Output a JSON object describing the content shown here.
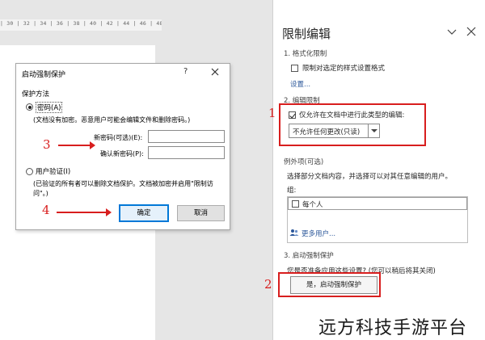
{
  "ruler": {
    "marks": "| 30 | 32 | 34 | 36 | 38 | 40 | 42 | 44 | 46 | 48"
  },
  "dialog": {
    "title": "启动强制保护",
    "help_glyph": "?",
    "protect_method_label": "保护方法",
    "password_option": "密码(A)",
    "password_desc": "(文档没有加密。恶意用户可能会编辑文件和删除密码。)",
    "new_password_label": "新密码(可选)(E):",
    "new_password_value": "",
    "confirm_password_label": "确认新密码(P):",
    "confirm_password_value": "",
    "user_auth_option": "用户验证(I)",
    "user_auth_desc": "(已验证的所有者可以删除文档保护。文档被加密并启用\"限制访问\"。)",
    "ok_label": "确定",
    "cancel_label": "取消"
  },
  "annotations": {
    "n1": "1",
    "n2": "2",
    "n3": "3",
    "n4": "4"
  },
  "pane": {
    "title": "限制编辑",
    "section1": {
      "heading": "1. 格式化限制",
      "checkbox_label": "限制对选定的样式设置格式",
      "checked": false,
      "settings_link": "设置..."
    },
    "section2": {
      "heading": "2. 编辑限制",
      "checkbox_label": "仅允许在文档中进行此类型的编辑:",
      "checked": true,
      "selected_option": "不允许任何更改(只读)",
      "exceptions_heading": "例外项(可选)",
      "exceptions_desc": "选择部分文档内容，并选择可以对其任意编辑的用户。",
      "groups_label": "组:",
      "groups": [
        {
          "label": "每个人",
          "checked": false
        }
      ],
      "more_users_link": "更多用户..."
    },
    "section3": {
      "heading": "3. 启动强制保护",
      "question": "您是否准备应用这些设置? (您可以稍后将其关闭)",
      "button_label": "是，启动强制保护"
    }
  },
  "watermark": "远方科技手游平台",
  "colors": {
    "annotation_red": "#d81e1e",
    "link_blue": "#2b579a",
    "focus_blue": "#0078d7"
  }
}
